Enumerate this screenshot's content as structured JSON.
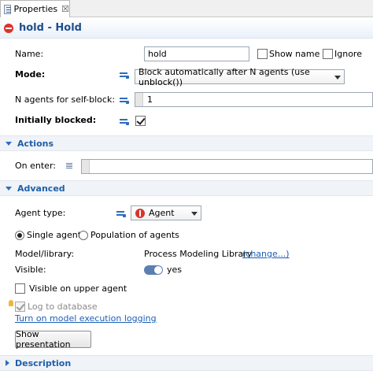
{
  "tab": {
    "label": "Properties",
    "close": "☒"
  },
  "header": {
    "title": "hold - Hold"
  },
  "fields": {
    "name_label": "Name:",
    "name_value": "hold",
    "show_name_label": "Show name",
    "ignore_label": "Ignore",
    "mode_label": "Mode:",
    "mode_value": "Block automatically after N agents (use unblock())",
    "n_agents_label": "N agents for self-block:",
    "n_agents_value": "1",
    "initially_blocked_label": "Initially blocked:",
    "initially_blocked_checked": true
  },
  "sections": {
    "actions": "Actions",
    "advanced": "Advanced",
    "description": "Description"
  },
  "actions": {
    "on_enter_label": "On enter:",
    "on_enter_value": ""
  },
  "advanced": {
    "agent_type_label": "Agent type:",
    "agent_type_value": "Agent",
    "single_agent_label": "Single agent",
    "population_label": "Population of agents",
    "model_library_label": "Model/library:",
    "model_library_value": "Process Modeling Library",
    "change_link": "(change...)",
    "visible_label": "Visible:",
    "visible_value": "yes",
    "visible_upper_label": "Visible on upper agent",
    "log_db_label": "Log to database",
    "logging_link": "Turn on model execution logging",
    "show_presentation_button": "Show presentation"
  },
  "colors": {
    "accent": "#1f5fa8",
    "section_bg": "#f0f3f8",
    "error_icon": "#d9342b"
  }
}
